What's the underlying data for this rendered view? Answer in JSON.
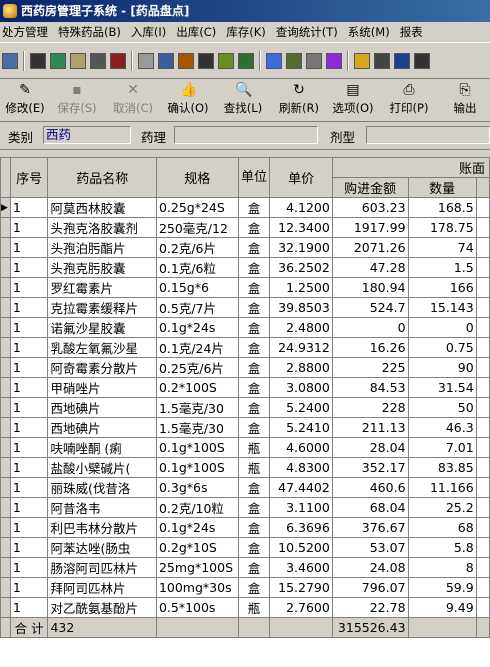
{
  "window": {
    "title": "西药房管理子系统 - [药品盘点]"
  },
  "menu": [
    "处方管理",
    "特殊药品(B)",
    "入库(I)",
    "出库(C)",
    "库存(K)",
    "查询统计(T)",
    "系统(M)",
    "报表"
  ],
  "icons": [
    "window-icon",
    "bag-icon",
    "check-icon",
    "calc-icon",
    "binoculars-icon",
    "shopping-icon",
    "copy-icon",
    "card-icon",
    "doc-edit-icon",
    "checkbox-icon",
    "clipboard-icon",
    "arrow-doc-icon",
    "form-icon",
    "list-icon",
    "printer-icon",
    "table-icon",
    "bell-icon",
    "badge-icon",
    "shirt-icon",
    "trash-icon"
  ],
  "toolbar": [
    {
      "name": "modify-button",
      "label": "修改(E)",
      "icon": "✎",
      "disabled": false
    },
    {
      "name": "save-button",
      "label": "保存(S)",
      "icon": "▪",
      "disabled": true
    },
    {
      "name": "cancel-button",
      "label": "取消(C)",
      "icon": "✕",
      "disabled": true
    },
    {
      "name": "confirm-button",
      "label": "确认(O)",
      "icon": "👍",
      "disabled": false
    },
    {
      "name": "find-button",
      "label": "查找(L)",
      "icon": "🔍",
      "disabled": false
    },
    {
      "name": "refresh-button",
      "label": "刷新(R)",
      "icon": "↻",
      "disabled": false
    },
    {
      "name": "options-button",
      "label": "选项(O)",
      "icon": "▤",
      "disabled": false
    },
    {
      "name": "print-button",
      "label": "打印(P)",
      "icon": "⎙",
      "disabled": false
    },
    {
      "name": "output-button",
      "label": "输出",
      "icon": "⎘",
      "disabled": false
    }
  ],
  "filters": {
    "category_label": "类别",
    "category_value": "西药",
    "pharm_label": "药理",
    "pharm_value": "",
    "form_label": "剂型",
    "form_value": ""
  },
  "table": {
    "group_header": "账面",
    "headers": [
      "序号",
      "药品名称",
      "规格",
      "单位",
      "单价",
      "购进金额",
      "数量"
    ],
    "rows": [
      [
        "1",
        "阿莫西林胶囊",
        "0.25g*24S",
        "盒",
        "4.1200",
        "603.23",
        "168.5"
      ],
      [
        "1",
        "头孢克洛胶囊剂",
        "250毫克/12",
        "盒",
        "12.3400",
        "1917.99",
        "178.75"
      ],
      [
        "1",
        "头孢泊肟酯片",
        "0.2克/6片",
        "盒",
        "32.1900",
        "2071.26",
        "74"
      ],
      [
        "1",
        "头孢克肟胶囊",
        "0.1克/6粒",
        "盒",
        "36.2502",
        "47.28",
        "1.5"
      ],
      [
        "1",
        "罗红霉素片",
        "0.15g*6",
        "盒",
        "1.2500",
        "180.94",
        "166"
      ],
      [
        "1",
        "克拉霉素缓释片",
        "0.5克/7片",
        "盒",
        "39.8503",
        "524.7",
        "15.143"
      ],
      [
        "1",
        "诺氟沙星胶囊",
        "0.1g*24s",
        "盒",
        "2.4800",
        "0",
        "0"
      ],
      [
        "1",
        "乳酸左氧氟沙星",
        "0.1克/24片",
        "盒",
        "24.9312",
        "16.26",
        "0.75"
      ],
      [
        "1",
        "阿奇霉素分散片",
        "0.25克/6片",
        "盒",
        "2.8800",
        "225",
        "90"
      ],
      [
        "1",
        "甲硝唑片",
        "0.2*100S",
        "盒",
        "3.0800",
        "84.53",
        "31.54"
      ],
      [
        "1",
        "西地碘片",
        "1.5毫克/30",
        "盒",
        "5.2400",
        "228",
        "50"
      ],
      [
        "1",
        "西地碘片",
        "1.5毫克/30",
        "盒",
        "5.2410",
        "211.13",
        "46.3"
      ],
      [
        "1",
        "呋喃唑酮 (痢",
        "0.1g*100S",
        "瓶",
        "4.6000",
        "28.04",
        "7.01"
      ],
      [
        "1",
        "盐酸小檗碱片(",
        "0.1g*100S",
        "瓶",
        "4.8300",
        "352.17",
        "83.85"
      ],
      [
        "1",
        "丽珠威(伐昔洛",
        "0.3g*6s",
        "盒",
        "47.4402",
        "460.6",
        "11.166"
      ],
      [
        "1",
        "阿昔洛韦",
        "0.2克/10粒",
        "盒",
        "3.1100",
        "68.04",
        "25.2"
      ],
      [
        "1",
        "利巴韦林分散片",
        "0.1g*24s",
        "盒",
        "6.3696",
        "376.67",
        "68"
      ],
      [
        "1",
        "阿苯达唑(肠虫",
        "0.2g*10S",
        "盒",
        "10.5200",
        "53.07",
        "5.8"
      ],
      [
        "1",
        "肠溶阿司匹林片",
        "25mg*100S",
        "盒",
        "3.4600",
        "24.08",
        "8"
      ],
      [
        "1",
        "拜阿司匹林片",
        "100mg*30s",
        "盒",
        "15.2790",
        "796.07",
        "59.9"
      ],
      [
        "1",
        "对乙酰氨基酚片",
        "0.5*100s",
        "瓶",
        "2.7600",
        "22.78",
        "9.49"
      ]
    ],
    "total": {
      "label": "合 计",
      "count": "432",
      "amount": "315526.43"
    }
  }
}
